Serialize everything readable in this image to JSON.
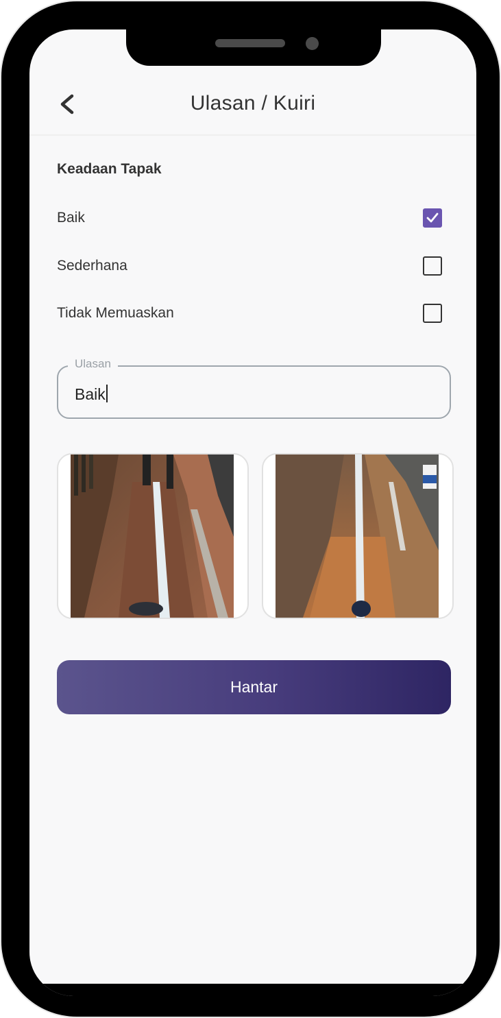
{
  "header": {
    "title": "Ulasan / Kuiri"
  },
  "site_condition": {
    "heading": "Keadaan Tapak",
    "options": [
      {
        "label": "Baik",
        "checked": true
      },
      {
        "label": "Sederhana",
        "checked": false
      },
      {
        "label": "Tidak Memuaskan",
        "checked": false
      }
    ]
  },
  "review": {
    "label": "Ulasan",
    "value": "Baik"
  },
  "photos": [
    {
      "icon": "trench-photo-1"
    },
    {
      "icon": "trench-photo-2"
    }
  ],
  "submit_label": "Hantar",
  "colors": {
    "accent": "#6a55b0",
    "button_start": "#5b548d",
    "button_end": "#2e2563"
  }
}
